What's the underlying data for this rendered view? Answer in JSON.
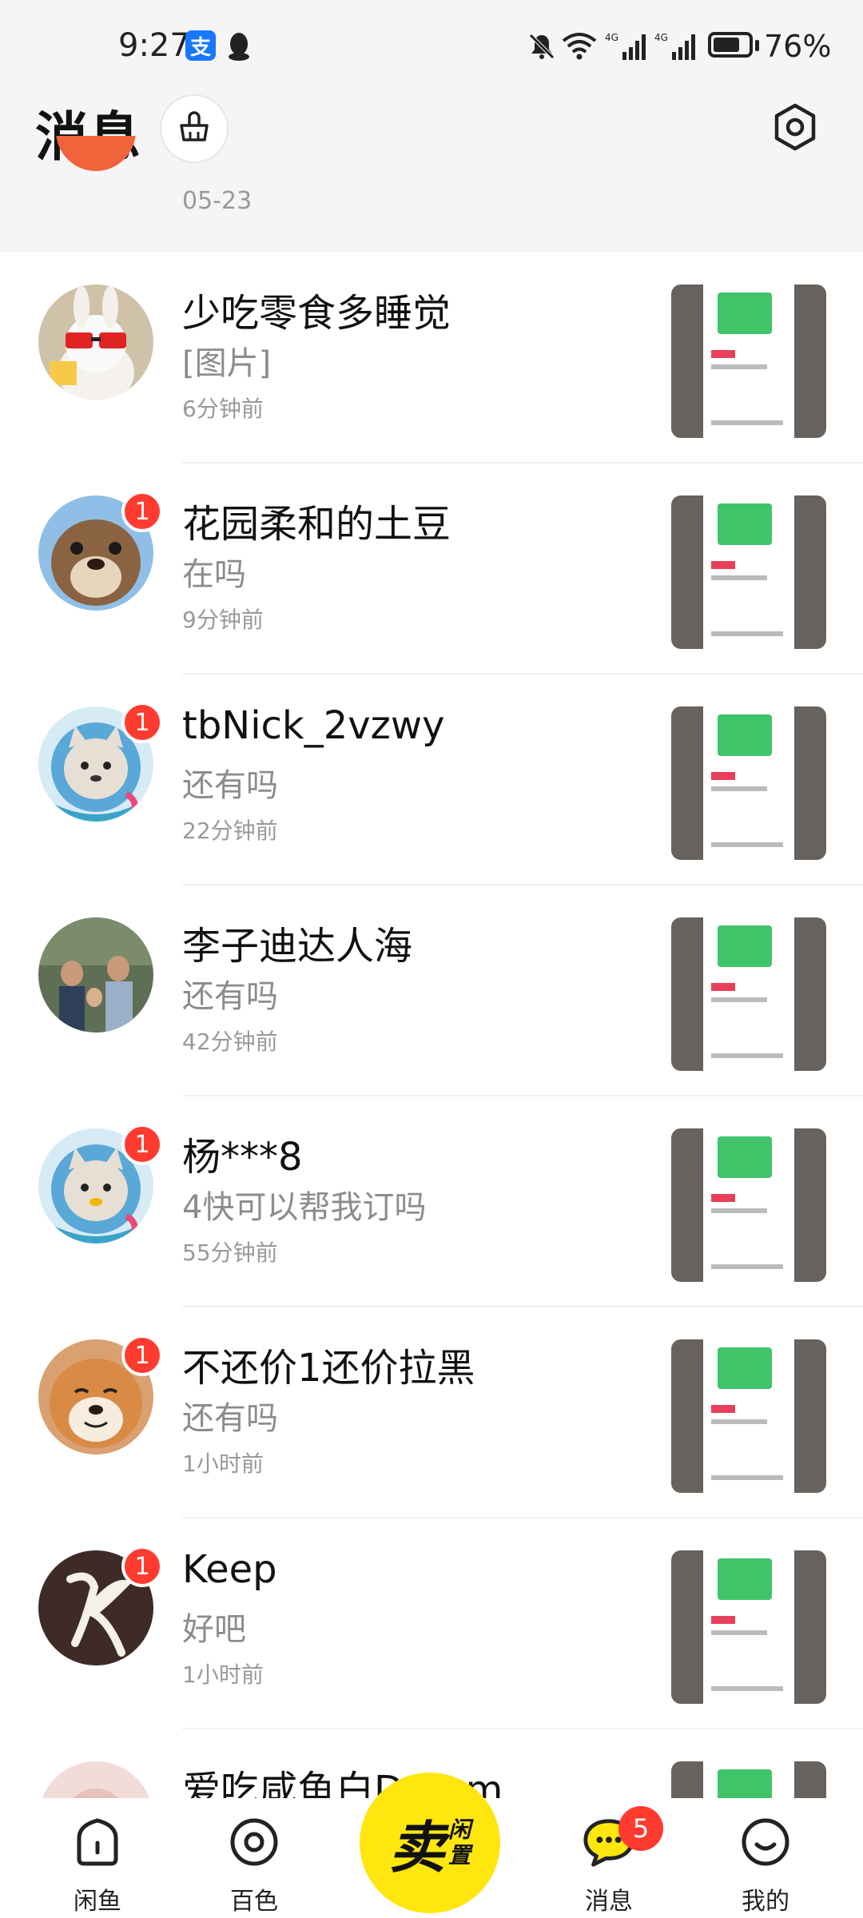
{
  "status_bar": {
    "time": "9:27",
    "alipay_glyph": "支",
    "battery_percent": "76%",
    "battery_level": 0.76,
    "icons": [
      "alipay-icon",
      "qq-icon",
      "mute-icon",
      "wifi-icon",
      "signal-4g-icon",
      "signal-4g-icon",
      "battery-icon"
    ]
  },
  "header": {
    "title": "消息",
    "clean_icon": "broom-icon",
    "settings_icon": "gear-icon"
  },
  "pinned": {
    "date": "05-23"
  },
  "conversations": [
    {
      "name": "少吃零食多睡觉",
      "preview": "[图片]",
      "time": "6分钟前",
      "unread": "",
      "avatar": "avatar-bunny"
    },
    {
      "name": "花园柔和的土豆",
      "preview": "在吗",
      "time": "9分钟前",
      "unread": "1",
      "avatar": "avatar-otter"
    },
    {
      "name": "tbNick_2vzwy",
      "preview": "还有吗",
      "time": "22分钟前",
      "unread": "1",
      "avatar": "avatar-default"
    },
    {
      "name": "李子迪达人海",
      "preview": "还有吗",
      "time": "42分钟前",
      "unread": "",
      "avatar": "avatar-photo"
    },
    {
      "name": "杨***8",
      "preview": "4快可以帮我订吗",
      "time": "55分钟前",
      "unread": "1",
      "avatar": "avatar-default"
    },
    {
      "name": "不还价1还价拉黑",
      "preview": "还有吗",
      "time": "1小时前",
      "unread": "1",
      "avatar": "avatar-dog"
    },
    {
      "name": "Keep",
      "preview": "好吧",
      "time": "1小时前",
      "unread": "1",
      "avatar": "avatar-keep"
    },
    {
      "name": "爱吃咸鱼白Dream",
      "preview": "",
      "time": "",
      "unread": "",
      "avatar": "avatar-pink"
    }
  ],
  "tab_bar": {
    "tabs": [
      {
        "label": "闲鱼",
        "icon": "home-icon"
      },
      {
        "label": "百色",
        "icon": "circle-target-icon"
      },
      {
        "label": "消息",
        "icon": "chat-bubble-icon",
        "badge": "5"
      },
      {
        "label": "我的",
        "icon": "smile-face-icon"
      }
    ],
    "sell": {
      "main": "卖",
      "sub_top": "闲",
      "sub_bottom": "置"
    }
  },
  "colors": {
    "accent_yellow": "#ffe60f",
    "badge_red": "#ff3b30",
    "header_bg": "#f5f5f5"
  }
}
